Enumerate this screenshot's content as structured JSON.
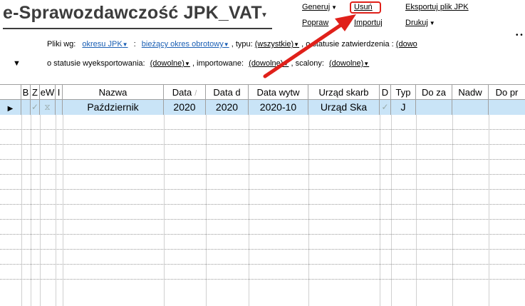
{
  "title": "e-Sprawozdawczość JPK_VAT",
  "menu": {
    "generuj": "Generuj",
    "usun": "Usuń",
    "eksportuj": "Eksportuj plik JPK",
    "popraw": "Popraw",
    "importuj": "Importuj",
    "drukuj": "Drukuj"
  },
  "filters": {
    "pliki_wg": "Pliki wg:",
    "okresu": "okresu JPK",
    "colon": ":",
    "biezacy": "bieżący okres obrotowy",
    "typu_label": ", typu:",
    "typu_value": "(wszystkie)",
    "zatw_label": ", o statusie zatwierdzenia :",
    "zatw_value": "(dowo",
    "wyeks_label": "o statusie wyeksportowania:",
    "wyeks_value": "(dowolne)",
    "import_label": ", importowane:",
    "import_value": "(dowolne)",
    "scalony_label": ", scalony:",
    "scalony_value": "(dowolne)"
  },
  "grid": {
    "headers": [
      "B",
      "Z",
      "eW",
      "I",
      "Nazwa",
      "Data",
      "Data d",
      "Data wytw",
      "Urząd skarb",
      "D",
      "Typ",
      "Do za",
      "Nadw",
      "Do pr"
    ],
    "rows": [
      [
        "",
        "✓",
        "⧖",
        "",
        "Październik",
        "2020",
        "2020",
        "2020-10",
        "Urząd Ska",
        "✓",
        "J",
        "",
        "",
        ""
      ]
    ]
  }
}
